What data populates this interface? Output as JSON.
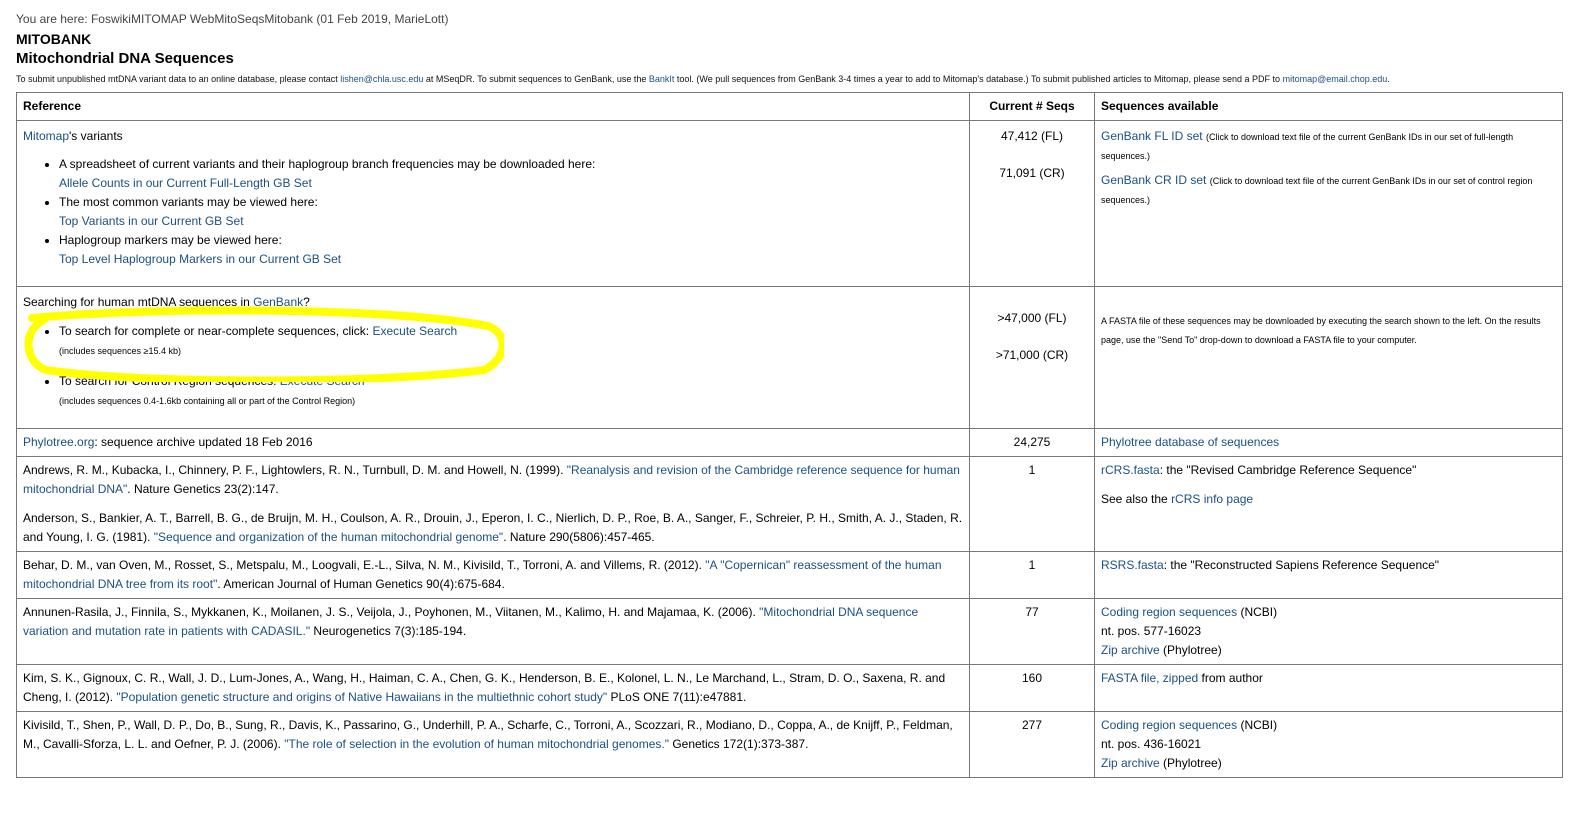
{
  "breadcrumb": {
    "prefix": "You are here: ",
    "foswiki": "Foswiki",
    "mitomap": "MITOMAP",
    "web": "WebMitoSeqsMitobank",
    "suffix": " (01 Feb 2019, MarieLott)"
  },
  "title": "MITOBANK",
  "subtitle": "Mitochondrial DNA Sequences",
  "intro": {
    "t1": "To submit unpublished mtDNA variant data to an online database, please contact ",
    "email1": "lishen@chla.usc.edu",
    "t2": " at MSeqDR. To submit sequences to GenBank, use the ",
    "bankit": "BankIt",
    "t3": " tool. (We pull sequences from GenBank 3-4 times a year to add to Mitomap's database.) To submit published articles to Mitomap, please send a PDF to ",
    "email2": "mitomap@email.chop.edu",
    "t4": "."
  },
  "table": {
    "headers": [
      "Reference",
      "Current # Seqs",
      "Sequences available"
    ],
    "r1": {
      "mitomap": "Mitomap",
      "variants": "'s variants",
      "b1": "A spreadsheet of current variants and their haplogroup branch frequencies may be downloaded here:",
      "b1_link": "Allele Counts in our Current Full-Length GB Set",
      "b2": "The most common variants may be viewed here:",
      "b2_link": "Top Variants in our Current GB Set",
      "b3": "Haplogroup markers may be viewed here:",
      "b3_link": "Top Level Haplogroup Markers in our Current GB Set",
      "count_fl": "47,412 (FL)",
      "count_cr": "71,091 (CR)",
      "fl_link": "GenBank FL ID set",
      "fl_note": "(Click to download text file of the current GenBank IDs in our set of full-length sequences.)",
      "cr_link": "GenBank CR ID set",
      "cr_note": "(Click to download text file of the current GenBank IDs in our set of control region sequences.)"
    },
    "r2": {
      "searching": "Searching for human mtDNA sequences in ",
      "genbank": "GenBank",
      "q": "?",
      "b1": "To search for complete or near-complete sequences, click: ",
      "b1_link": "Execute Search",
      "b1_note": "(includes sequences ≥15.4 kb)",
      "b2": "To search for Control Region sequences: ",
      "b2_link": "Execute Search",
      "b2_note": "(includes sequences 0.4-1.6kb containing all or part of the Control Region)",
      "count_fl": ">47,000 (FL)",
      "count_cr": ">71,000 (CR)",
      "fasta_note": "A FASTA file of these sequences may be downloaded by executing the search shown to the left. On the results page, use the \"Send To\" drop-down to download a FASTA file to your computer."
    },
    "r3": {
      "link": "Phylotree.org",
      "text": ": sequence archive updated 18 Feb 2016",
      "count": "24,275",
      "seq_link": "Phylotree database of sequences"
    },
    "r4": {
      "a1": "Andrews, R. M., Kubacka, I., Chinnery, P. F., Lightowlers, R. N., Turnbull, D. M. and Howell, N. (1999). ",
      "a1_link": "\"Reanalysis and revision of the Cambridge reference sequence for human mitochondrial DNA\"",
      "a1_tail": ". Nature Genetics 23(2):147.",
      "a2": "Anderson, S., Bankier, A. T., Barrell, B. G., de Bruijn, M. H., Coulson, A. R., Drouin, J., Eperon, I. C., Nierlich, D. P., Roe, B. A., Sanger, F., Schreier, P. H., Smith, A. J., Staden, R. and Young, I. G. (1981). ",
      "a2_link": "\"Sequence and organization of the human mitochondrial genome\"",
      "a2_tail": ". Nature 290(5806):457-465.",
      "count": "1",
      "seq_link": "rCRS.fasta",
      "seq_text": ": the \"Revised Cambridge Reference Sequence\"",
      "see_also": "See also the ",
      "info_link": "rCRS info page"
    },
    "r5": {
      "a": "Behar, D. M., van Oven, M., Rosset, S., Metspalu, M., Loogvali, E.-L., Silva, N. M., Kivisild, T., Torroni, A. and Villems, R. (2012). ",
      "link": "\"A \"Copernican\" reassessment of the human mitochondrial DNA tree from its root\"",
      "tail": ". American Journal of Human Genetics 90(4):675-684.",
      "count": "1",
      "seq_link": "RSRS.fasta",
      "seq_text": ": the \"Reconstructed Sapiens Reference Sequence\""
    },
    "r6": {
      "a": "Annunen-Rasila, J., Finnila, S., Mykkanen, K., Moilanen, J. S., Veijola, J., Poyhonen, M., Viitanen, M., Kalimo, H. and Majamaa, K. (2006). ",
      "link": "\"Mitochondrial DNA sequence variation and mutation rate in patients with CADASIL.\"",
      "tail": " Neurogenetics 7(3):185-194.",
      "count": "77",
      "seq_link": "Coding region sequences",
      "ncbi": " (NCBI)",
      "pos": "nt. pos. 577-16023",
      "zip": "Zip archive",
      "phylo": " (Phylotree)"
    },
    "r7": {
      "a": "Kim, S. K., Gignoux, C. R., Wall, J. D., Lum-Jones, A., Wang, H., Haiman, C. A., Chen, G. K., Henderson, B. E., Kolonel, L. N., Le Marchand, L., Stram, D. O., Saxena, R. and Cheng, I. (2012). ",
      "link": "\"Population genetic structure and origins of Native Hawaiians in the multiethnic cohort study\"",
      "tail": " PLoS ONE 7(11):e47881.",
      "count": "160",
      "seq_link": "FASTA file, zipped",
      "seq_text": " from author"
    },
    "r8": {
      "a": "Kivisild, T., Shen, P., Wall, D. P., Do, B., Sung, R., Davis, K., Passarino, G., Underhill, P. A., Scharfe, C., Torroni, A., Scozzari, R., Modiano, D., Coppa, A., de Knijff, P., Feldman, M., Cavalli-Sforza, L. L. and Oefner, P. J. (2006). ",
      "link": "\"The role of selection in the evolution of human mitochondrial genomes.\"",
      "tail": "   Genetics 172(1):373-387.",
      "count": "277",
      "seq_link": "Coding region sequences",
      "ncbi": " (NCBI)",
      "pos": "nt. pos. 436-16021",
      "zip": "Zip archive",
      "phylo": " (Phylotree)"
    }
  },
  "colors": {
    "link": "#1a5082",
    "highlight": "#ffff00"
  }
}
